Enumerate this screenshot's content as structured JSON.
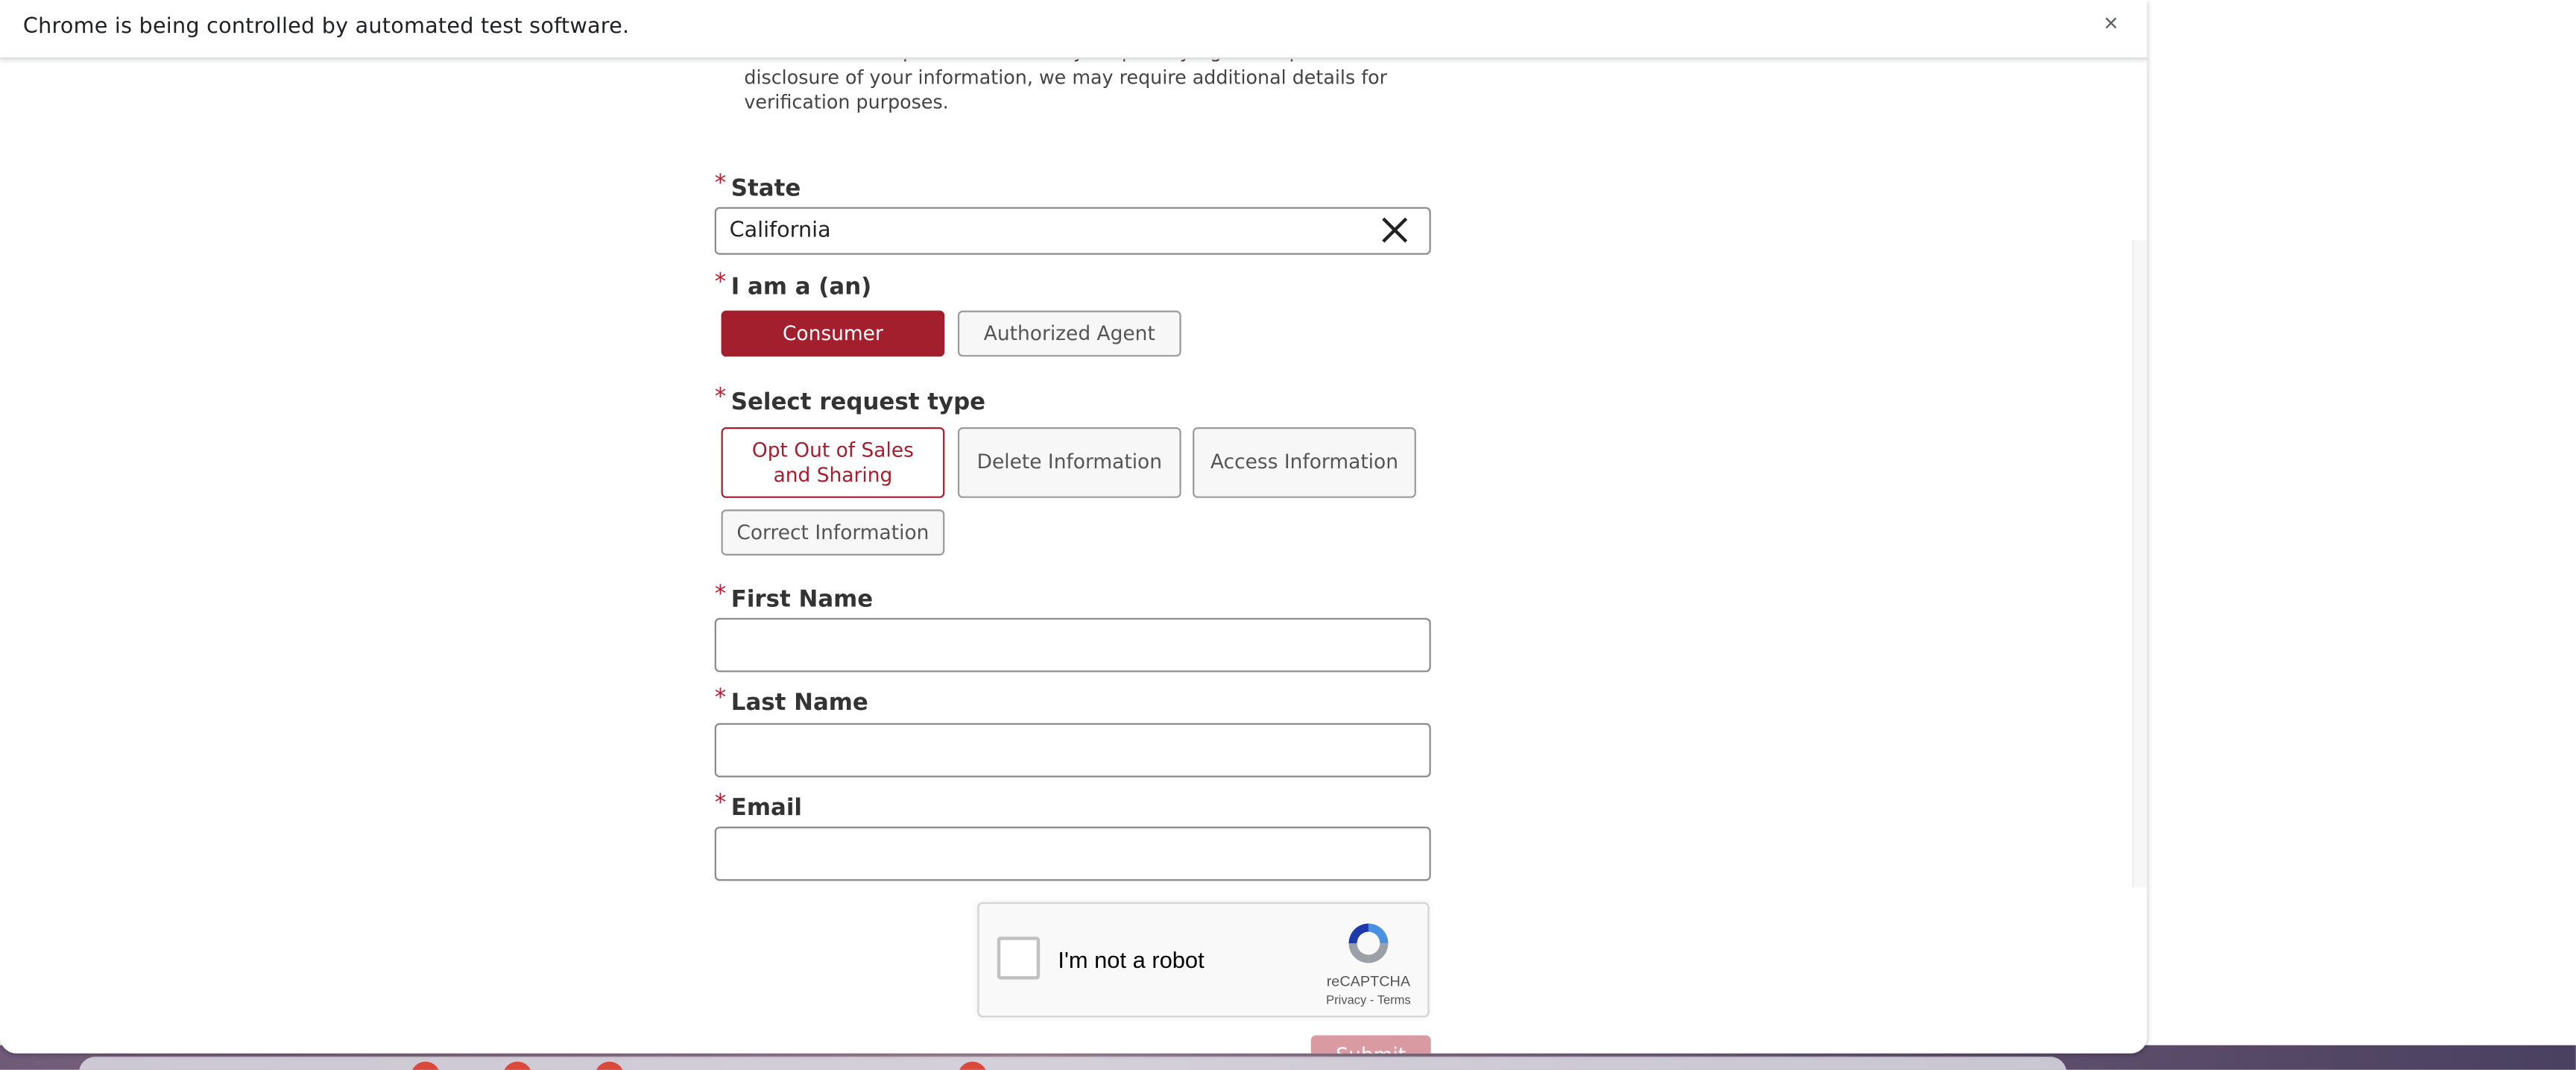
{
  "browser": {
    "infobar_text": "Chrome is being controlled by automated test software.",
    "infobar_close": "×"
  },
  "form": {
    "intro_text": "You can use this portal to exercise your privacy rights. To protect the disclosure of your information, we may require additional details for verification purposes.",
    "required_marker": "*",
    "state": {
      "label": "State",
      "value": "California"
    },
    "iam": {
      "label": "I am a (an)",
      "options": [
        "Consumer",
        "Authorized Agent"
      ],
      "selected": "Consumer"
    },
    "request_type": {
      "label": "Select request type",
      "options": [
        "Opt Out of Sales and Sharing",
        "Delete Information",
        "Access Information",
        "Correct Information"
      ],
      "selected": "Opt Out of Sales and Sharing"
    },
    "first_name": {
      "label": "First Name",
      "value": ""
    },
    "last_name": {
      "label": "Last Name",
      "value": ""
    },
    "email": {
      "label": "Email",
      "value": ""
    },
    "captcha": {
      "text": "I'm not a robot",
      "brand": "reCAPTCHA",
      "links": "Privacy - Terms"
    },
    "submit_label": "Submit"
  },
  "colors": {
    "accent": "#a31f2e",
    "required": "#b42032",
    "submit_disabled": "#d99aa2"
  },
  "icons": {
    "infobar_close": "close-icon",
    "state_clear": "clear-x-icon",
    "captcha_logo": "recaptcha-logo-icon"
  }
}
